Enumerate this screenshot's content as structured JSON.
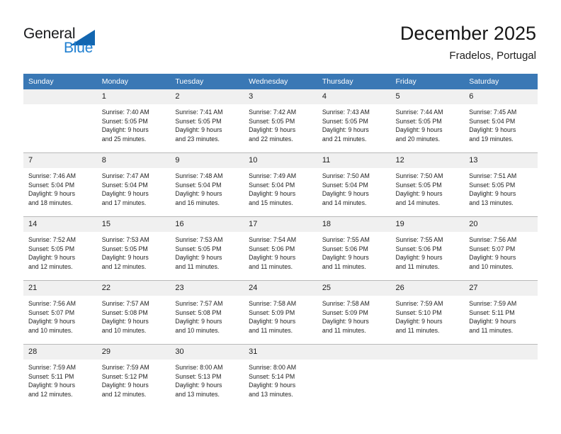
{
  "brand": {
    "name_part1": "General",
    "name_part2": "Blue",
    "triangle_color": "#1266b0",
    "blue_color": "#1f7fd0"
  },
  "header": {
    "title": "December 2025",
    "location": "Fradelos, Portugal",
    "header_bg_color": "#3a78b5",
    "daynum_bg_color": "#f0f0f0"
  },
  "weekday_headers": [
    "Sunday",
    "Monday",
    "Tuesday",
    "Wednesday",
    "Thursday",
    "Friday",
    "Saturday"
  ],
  "labels": {
    "sunrise_prefix": "Sunrise:",
    "sunset_prefix": "Sunset:",
    "daylight_prefix": "Daylight:"
  },
  "weeks": [
    [
      {
        "day": "",
        "line1": "",
        "line2": "",
        "line3": "",
        "line4": ""
      },
      {
        "day": "1",
        "line1": "Sunrise: 7:40 AM",
        "line2": "Sunset: 5:05 PM",
        "line3": "Daylight: 9 hours",
        "line4": "and 25 minutes."
      },
      {
        "day": "2",
        "line1": "Sunrise: 7:41 AM",
        "line2": "Sunset: 5:05 PM",
        "line3": "Daylight: 9 hours",
        "line4": "and 23 minutes."
      },
      {
        "day": "3",
        "line1": "Sunrise: 7:42 AM",
        "line2": "Sunset: 5:05 PM",
        "line3": "Daylight: 9 hours",
        "line4": "and 22 minutes."
      },
      {
        "day": "4",
        "line1": "Sunrise: 7:43 AM",
        "line2": "Sunset: 5:05 PM",
        "line3": "Daylight: 9 hours",
        "line4": "and 21 minutes."
      },
      {
        "day": "5",
        "line1": "Sunrise: 7:44 AM",
        "line2": "Sunset: 5:05 PM",
        "line3": "Daylight: 9 hours",
        "line4": "and 20 minutes."
      },
      {
        "day": "6",
        "line1": "Sunrise: 7:45 AM",
        "line2": "Sunset: 5:04 PM",
        "line3": "Daylight: 9 hours",
        "line4": "and 19 minutes."
      }
    ],
    [
      {
        "day": "7",
        "line1": "Sunrise: 7:46 AM",
        "line2": "Sunset: 5:04 PM",
        "line3": "Daylight: 9 hours",
        "line4": "and 18 minutes."
      },
      {
        "day": "8",
        "line1": "Sunrise: 7:47 AM",
        "line2": "Sunset: 5:04 PM",
        "line3": "Daylight: 9 hours",
        "line4": "and 17 minutes."
      },
      {
        "day": "9",
        "line1": "Sunrise: 7:48 AM",
        "line2": "Sunset: 5:04 PM",
        "line3": "Daylight: 9 hours",
        "line4": "and 16 minutes."
      },
      {
        "day": "10",
        "line1": "Sunrise: 7:49 AM",
        "line2": "Sunset: 5:04 PM",
        "line3": "Daylight: 9 hours",
        "line4": "and 15 minutes."
      },
      {
        "day": "11",
        "line1": "Sunrise: 7:50 AM",
        "line2": "Sunset: 5:04 PM",
        "line3": "Daylight: 9 hours",
        "line4": "and 14 minutes."
      },
      {
        "day": "12",
        "line1": "Sunrise: 7:50 AM",
        "line2": "Sunset: 5:05 PM",
        "line3": "Daylight: 9 hours",
        "line4": "and 14 minutes."
      },
      {
        "day": "13",
        "line1": "Sunrise: 7:51 AM",
        "line2": "Sunset: 5:05 PM",
        "line3": "Daylight: 9 hours",
        "line4": "and 13 minutes."
      }
    ],
    [
      {
        "day": "14",
        "line1": "Sunrise: 7:52 AM",
        "line2": "Sunset: 5:05 PM",
        "line3": "Daylight: 9 hours",
        "line4": "and 12 minutes."
      },
      {
        "day": "15",
        "line1": "Sunrise: 7:53 AM",
        "line2": "Sunset: 5:05 PM",
        "line3": "Daylight: 9 hours",
        "line4": "and 12 minutes."
      },
      {
        "day": "16",
        "line1": "Sunrise: 7:53 AM",
        "line2": "Sunset: 5:05 PM",
        "line3": "Daylight: 9 hours",
        "line4": "and 11 minutes."
      },
      {
        "day": "17",
        "line1": "Sunrise: 7:54 AM",
        "line2": "Sunset: 5:06 PM",
        "line3": "Daylight: 9 hours",
        "line4": "and 11 minutes."
      },
      {
        "day": "18",
        "line1": "Sunrise: 7:55 AM",
        "line2": "Sunset: 5:06 PM",
        "line3": "Daylight: 9 hours",
        "line4": "and 11 minutes."
      },
      {
        "day": "19",
        "line1": "Sunrise: 7:55 AM",
        "line2": "Sunset: 5:06 PM",
        "line3": "Daylight: 9 hours",
        "line4": "and 11 minutes."
      },
      {
        "day": "20",
        "line1": "Sunrise: 7:56 AM",
        "line2": "Sunset: 5:07 PM",
        "line3": "Daylight: 9 hours",
        "line4": "and 10 minutes."
      }
    ],
    [
      {
        "day": "21",
        "line1": "Sunrise: 7:56 AM",
        "line2": "Sunset: 5:07 PM",
        "line3": "Daylight: 9 hours",
        "line4": "and 10 minutes."
      },
      {
        "day": "22",
        "line1": "Sunrise: 7:57 AM",
        "line2": "Sunset: 5:08 PM",
        "line3": "Daylight: 9 hours",
        "line4": "and 10 minutes."
      },
      {
        "day": "23",
        "line1": "Sunrise: 7:57 AM",
        "line2": "Sunset: 5:08 PM",
        "line3": "Daylight: 9 hours",
        "line4": "and 10 minutes."
      },
      {
        "day": "24",
        "line1": "Sunrise: 7:58 AM",
        "line2": "Sunset: 5:09 PM",
        "line3": "Daylight: 9 hours",
        "line4": "and 11 minutes."
      },
      {
        "day": "25",
        "line1": "Sunrise: 7:58 AM",
        "line2": "Sunset: 5:09 PM",
        "line3": "Daylight: 9 hours",
        "line4": "and 11 minutes."
      },
      {
        "day": "26",
        "line1": "Sunrise: 7:59 AM",
        "line2": "Sunset: 5:10 PM",
        "line3": "Daylight: 9 hours",
        "line4": "and 11 minutes."
      },
      {
        "day": "27",
        "line1": "Sunrise: 7:59 AM",
        "line2": "Sunset: 5:11 PM",
        "line3": "Daylight: 9 hours",
        "line4": "and 11 minutes."
      }
    ],
    [
      {
        "day": "28",
        "line1": "Sunrise: 7:59 AM",
        "line2": "Sunset: 5:11 PM",
        "line3": "Daylight: 9 hours",
        "line4": "and 12 minutes."
      },
      {
        "day": "29",
        "line1": "Sunrise: 7:59 AM",
        "line2": "Sunset: 5:12 PM",
        "line3": "Daylight: 9 hours",
        "line4": "and 12 minutes."
      },
      {
        "day": "30",
        "line1": "Sunrise: 8:00 AM",
        "line2": "Sunset: 5:13 PM",
        "line3": "Daylight: 9 hours",
        "line4": "and 13 minutes."
      },
      {
        "day": "31",
        "line1": "Sunrise: 8:00 AM",
        "line2": "Sunset: 5:14 PM",
        "line3": "Daylight: 9 hours",
        "line4": "and 13 minutes."
      },
      {
        "day": "",
        "line1": "",
        "line2": "",
        "line3": "",
        "line4": ""
      },
      {
        "day": "",
        "line1": "",
        "line2": "",
        "line3": "",
        "line4": ""
      },
      {
        "day": "",
        "line1": "",
        "line2": "",
        "line3": "",
        "line4": ""
      }
    ]
  ]
}
